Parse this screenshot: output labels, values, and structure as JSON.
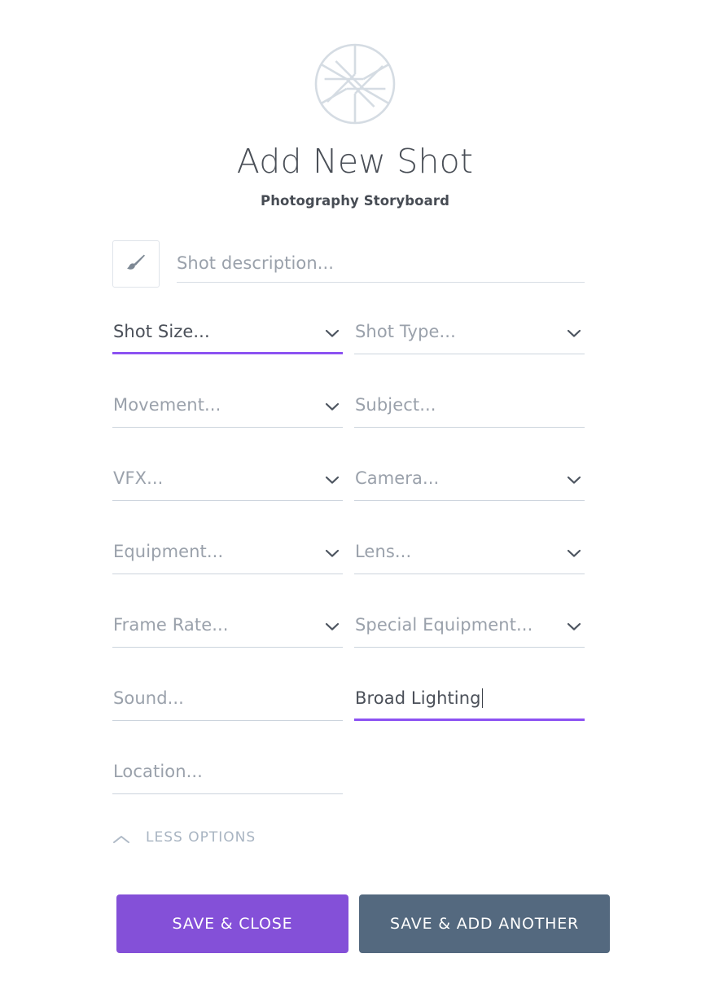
{
  "header": {
    "logo_icon": "aperture-icon",
    "title": "Add New Shot",
    "subtitle": "Photography Storyboard"
  },
  "colors": {
    "accent_purple": "#8c52f2",
    "primary_button": "#8450d8",
    "secondary_button": "#54697f",
    "placeholder_text": "#9aa1ab",
    "underline_inactive": "#ccd4dd",
    "logo": "#d5dce3"
  },
  "form": {
    "description": {
      "icon": "paintbrush-icon",
      "placeholder": "Shot description...",
      "value": ""
    },
    "rows": [
      [
        {
          "name": "shot-size",
          "label": "Shot Size...",
          "type": "select",
          "state": "focused",
          "chevron": true
        },
        {
          "name": "shot-type",
          "label": "Shot Type...",
          "type": "select",
          "state": "empty",
          "chevron": true
        }
      ],
      [
        {
          "name": "movement",
          "label": "Movement...",
          "type": "select",
          "state": "empty",
          "chevron": true
        },
        {
          "name": "subject",
          "label": "Subject...",
          "type": "text",
          "state": "empty",
          "chevron": false
        }
      ],
      [
        {
          "name": "vfx",
          "label": "VFX...",
          "type": "select",
          "state": "empty",
          "chevron": true
        },
        {
          "name": "camera",
          "label": "Camera...",
          "type": "select",
          "state": "empty",
          "chevron": true
        }
      ],
      [
        {
          "name": "equipment",
          "label": "Equipment...",
          "type": "select",
          "state": "empty",
          "chevron": true
        },
        {
          "name": "lens",
          "label": "Lens...",
          "type": "select",
          "state": "empty",
          "chevron": true
        }
      ],
      [
        {
          "name": "frame-rate",
          "label": "Frame Rate...",
          "type": "select",
          "state": "empty",
          "chevron": true
        },
        {
          "name": "special-equipment",
          "label": "Special Equipment...",
          "type": "select",
          "state": "empty",
          "chevron": true
        }
      ],
      [
        {
          "name": "sound",
          "label": "Sound...",
          "type": "text",
          "state": "empty",
          "chevron": false
        },
        {
          "name": "lighting",
          "label": "Broad Lighting",
          "type": "text",
          "state": "filled-focused",
          "chevron": false
        }
      ],
      [
        {
          "name": "location",
          "label": "Location...",
          "type": "text",
          "state": "empty",
          "chevron": false
        },
        {
          "name": "blank",
          "label": "",
          "type": "none",
          "state": "hidden",
          "chevron": false
        }
      ]
    ]
  },
  "less_options": {
    "icon": "chevron-up-icon",
    "label": "LESS OPTIONS"
  },
  "actions": {
    "save_close": "SAVE & CLOSE",
    "save_add_another": "SAVE & ADD ANOTHER"
  }
}
